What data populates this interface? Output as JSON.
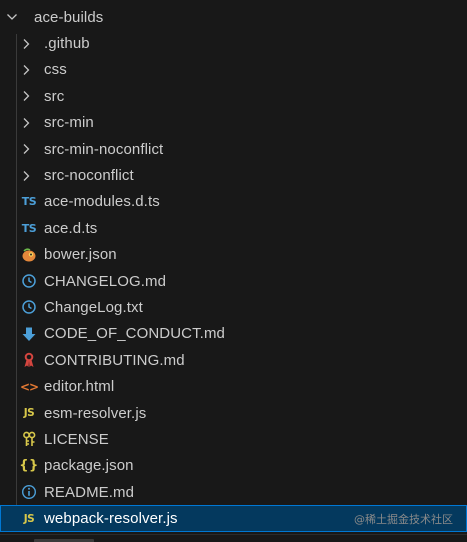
{
  "explorer": {
    "root": {
      "label": "ace-builds",
      "expanded": true
    },
    "folders": [
      {
        "label": ".github"
      },
      {
        "label": "css"
      },
      {
        "label": "src"
      },
      {
        "label": "src-min"
      },
      {
        "label": "src-min-noconflict"
      },
      {
        "label": "src-noconflict"
      }
    ],
    "files": [
      {
        "label": "ace-modules.d.ts",
        "icon": "typescript-icon",
        "badge": "TS"
      },
      {
        "label": "ace.d.ts",
        "icon": "typescript-icon",
        "badge": "TS"
      },
      {
        "label": "bower.json",
        "icon": "bower-icon"
      },
      {
        "label": "CHANGELOG.md",
        "icon": "changelog-icon"
      },
      {
        "label": "ChangeLog.txt",
        "icon": "changelog-icon"
      },
      {
        "label": "CODE_OF_CONDUCT.md",
        "icon": "code-of-conduct-icon"
      },
      {
        "label": "CONTRIBUTING.md",
        "icon": "contributing-icon"
      },
      {
        "label": "editor.html",
        "icon": "html-icon",
        "badge": "<>"
      },
      {
        "label": "esm-resolver.js",
        "icon": "javascript-icon",
        "badge": "JS"
      },
      {
        "label": "LICENSE",
        "icon": "license-icon"
      },
      {
        "label": "package.json",
        "icon": "json-icon",
        "badge": "{}"
      },
      {
        "label": "README.md",
        "icon": "info-icon"
      },
      {
        "label": "webpack-resolver.js",
        "icon": "javascript-icon",
        "badge": "JS",
        "selected": true
      }
    ]
  },
  "watermark": "@稀土掘金技术社区",
  "colors": {
    "background": "#181818",
    "selection": "#04395e",
    "selection_border": "#0078d4",
    "text": "#cccccc",
    "typescript": "#4c9fd8",
    "javascript": "#d8c84a",
    "html": "#e37933"
  }
}
